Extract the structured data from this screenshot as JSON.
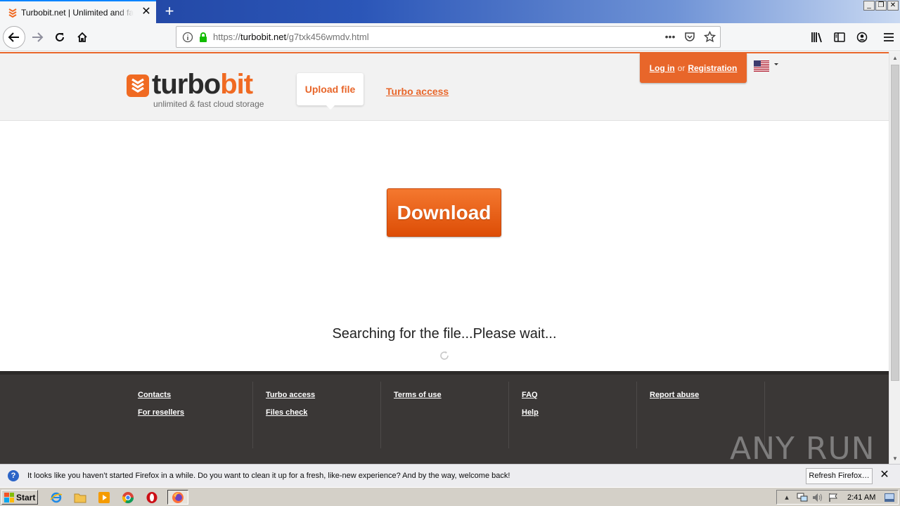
{
  "browser": {
    "tab_title": "Turbobit.net | Unlimited and fast fi",
    "url_prefix": "https://",
    "url_host": "turbobit.net",
    "url_path": "/g7txk456wmdv.html",
    "tab_close_glyph": "✕",
    "new_tab_glyph": "+",
    "page_actions_glyph": "•••",
    "window_buttons": [
      "_",
      "❐",
      "✕"
    ]
  },
  "site": {
    "logo_prefix": "turbo",
    "logo_suffix": "bit",
    "logo_tagline": "unlimited & fast cloud storage",
    "upload_label": "Upload file",
    "turbo_access_label": "Turbo access",
    "login_label": "Log in",
    "or_label": "or",
    "registration_label": "Registration",
    "download_label": "Download",
    "search_message": "Searching for the file...Please wait..."
  },
  "footer": {
    "columns": [
      [
        "Contacts",
        "For resellers"
      ],
      [
        "Turbo access",
        "Files check"
      ],
      [
        "Terms of use"
      ],
      [
        "FAQ",
        "Help"
      ],
      [
        "Report abuse"
      ]
    ],
    "watermark": "ANY RUN"
  },
  "notification": {
    "text": "It looks like you haven’t started Firefox in a while. Do you want to clean it up for a fresh, like-new experience? And by the way, welcome back!",
    "button_label": "Refresh Firefox…",
    "info_glyph": "?",
    "close_glyph": "✕"
  },
  "taskbar": {
    "start_label": "Start",
    "clock": "2:41 AM"
  },
  "colors": {
    "accent": "#e8662a",
    "footer_bg": "#3a3736",
    "firefox_blue": "#0a84ff"
  }
}
